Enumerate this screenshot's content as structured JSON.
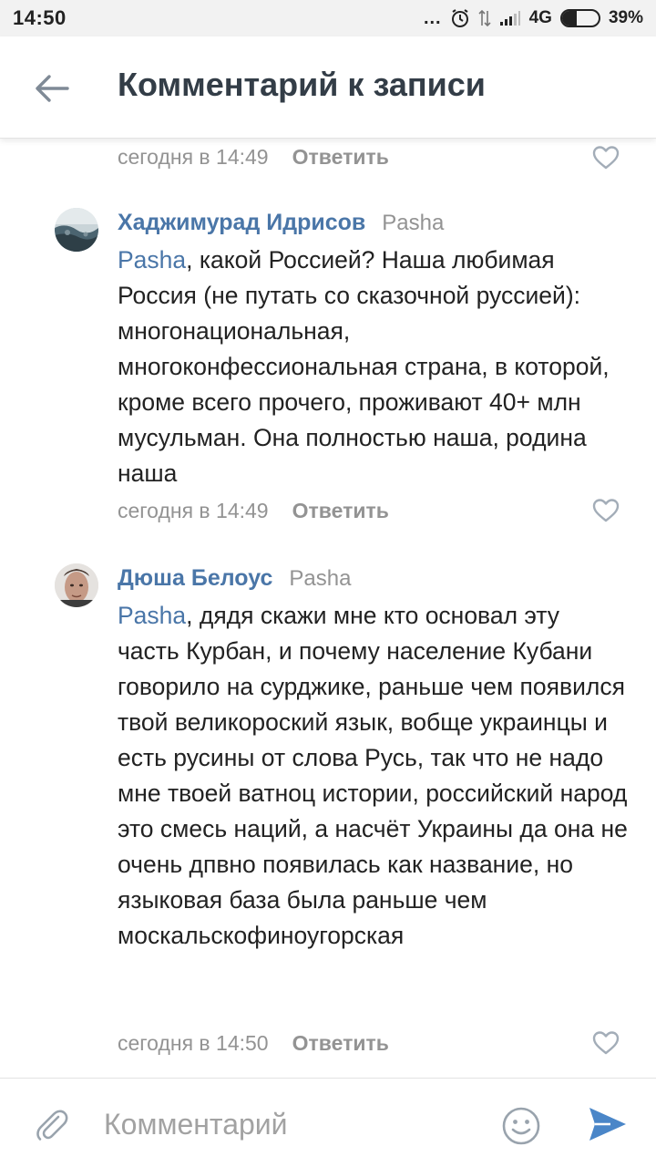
{
  "status_bar": {
    "time": "14:50",
    "dots": "...",
    "network": "4G",
    "battery_text": "39%",
    "battery_level": 0.39,
    "icons": [
      "alarm-icon",
      "data-arrows-icon",
      "signal-icon"
    ]
  },
  "header": {
    "back_icon": "arrow-left-icon",
    "title": "Комментарий к записи"
  },
  "top_meta": {
    "time": "сегодня в 14:49",
    "reply": "Ответить"
  },
  "comments": [
    {
      "author": "Хаджимурад Идрисов",
      "reply_to": "Pasha",
      "mention": "Pasha",
      "text": ", какой Россией? Наша любимая Россия (не путать со сказочной руссией): многонациональная, многоконфессиональная страна, в которой, кроме всего прочего, проживают 40+ млн мусульман. Она полностью наша, родина наша",
      "time": "сегодня в 14:49",
      "reply": "Ответить"
    },
    {
      "author": "Дюша Белоус",
      "reply_to": "Pasha",
      "mention": "Pasha",
      "text": ", дядя скажи мне кто основал эту часть Курбан, и почему население Кубани говорило на сурджике, раньше чем появился твой великороский язык, вобще украинцы и есть русины от слова Русь, так что не надо мне твоей ватноц истории, российский народ это смесь наций, а насчёт Украины да она не очень дпвно появилась как название, но языковая база была раньше чем москальскофиноугорская",
      "time": "сегодня в 14:50",
      "reply": "Ответить"
    }
  ],
  "composer": {
    "placeholder": "Комментарий",
    "attach_icon": "paperclip-icon",
    "emoji_icon": "smile-icon",
    "send_icon": "send-icon"
  },
  "colors": {
    "accent": "#4a76a8",
    "muted": "#939393",
    "title": "#333d47"
  }
}
